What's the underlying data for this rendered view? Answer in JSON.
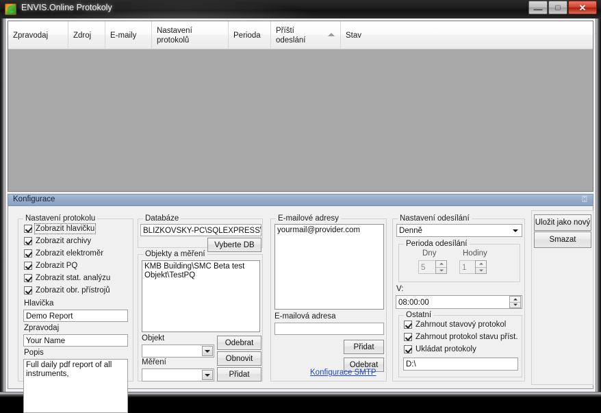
{
  "window": {
    "title": "ENVIS.Online Protokoly",
    "icon": "envis-logo-icon",
    "minimize_label": "—",
    "maximize_label": "□",
    "close_label": "✕"
  },
  "grid": {
    "columns": [
      {
        "label": "Zpravodaj",
        "sorted": false
      },
      {
        "label": "Zdroj",
        "sorted": false
      },
      {
        "label": "E-maily",
        "sorted": false
      },
      {
        "label": "Nastavení\nprotokolů",
        "sorted": false
      },
      {
        "label": "Perioda",
        "sorted": false
      },
      {
        "label": "Příští\nodeslání",
        "sorted": true
      },
      {
        "label": "Stav",
        "sorted": false
      }
    ],
    "rows": []
  },
  "config_tab": {
    "label": "Konfigurace",
    "pin_icon": "⍠"
  },
  "protocol_settings": {
    "group_title": "Nastavení protokolu",
    "checkboxes": [
      {
        "label": "Zobrazit hlavičku",
        "checked": true,
        "focused": true
      },
      {
        "label": "Zobrazit archivy",
        "checked": true,
        "focused": false
      },
      {
        "label": "Zobrazit elektroměr",
        "checked": true,
        "focused": false
      },
      {
        "label": "Zobrazit PQ",
        "checked": true,
        "focused": false
      },
      {
        "label": "Zobrazit stat. analýzu",
        "checked": true,
        "focused": false
      },
      {
        "label": "Zobrazit obr. přístrojů",
        "checked": true,
        "focused": false
      }
    ],
    "header_label": "Hlavička",
    "header_value": "Demo Report",
    "reporter_label": "Zpravodaj",
    "reporter_value": "Your Name",
    "description_label": "Popis",
    "description_value": "Full daily pdf report of all instruments,"
  },
  "database": {
    "group_title": "Databáze",
    "connection_value": "BLIZKOVSKY-PC\\SQLEXPRESS\\SM",
    "select_db_button": "Vyberte DB"
  },
  "objects": {
    "group_title": "Objekty a měření",
    "list_items": [
      "KMB Building\\SMC Beta test",
      "Objekt\\TestPQ"
    ],
    "object_label": "Objekt",
    "object_value": "",
    "measurement_label": "Měření",
    "measurement_value": "",
    "remove_button": "Odebrat",
    "refresh_button": "Obnovit",
    "add_button": "Přidat"
  },
  "emails": {
    "group_title": "E-mailové adresy",
    "list_items": [
      "yourmail@provider.com"
    ],
    "address_label": "E-mailová adresa",
    "address_value": "",
    "add_button": "Přidat",
    "remove_button": "Odebrat",
    "smtp_link": "Konfigurace SMTP"
  },
  "sending": {
    "group_title": "Nastavení odesílání",
    "frequency_value": "Denně",
    "period_group_title": "Perioda odesílání",
    "days_label": "Dny",
    "days_value": "5",
    "hours_label": "Hodiny",
    "hours_value": "1",
    "at_label": "V:",
    "at_value": "08:00:00",
    "other_group_title": "Ostatní",
    "other_checkboxes": [
      {
        "label": "Zahrnout stavový protokol",
        "checked": true
      },
      {
        "label": "Zahrnout protokol stavu příst.",
        "checked": true
      },
      {
        "label": "Ukládat protokoly",
        "checked": true
      }
    ],
    "path_value": "D:\\"
  },
  "actions": {
    "save_as_new_button": "Uložit jako nový",
    "delete_button": "Smazat"
  },
  "colors": {
    "tab_accent": "#94abc8",
    "link": "#1a47c8",
    "grid_body": "#a8a8a8",
    "close_button": "#d2402b"
  }
}
